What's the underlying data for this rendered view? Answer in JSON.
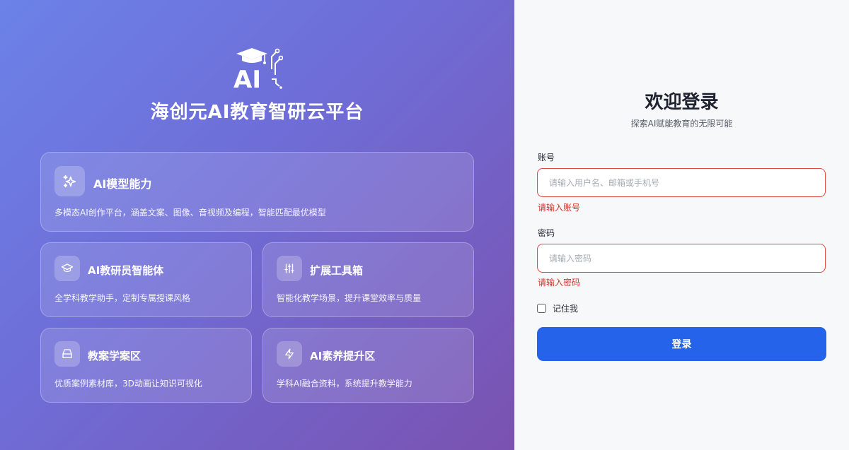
{
  "brand": {
    "logo_text": "AI",
    "title": "海创元AI教育智研云平台"
  },
  "features": [
    {
      "icon": "sparkles-icon",
      "title": "AI模型能力",
      "desc": "多模态AI创作平台，涵盖文案、图像、音视频及编程，智能匹配最优模型"
    },
    {
      "icon": "graduation-cap-icon",
      "title": "AI教研员智能体",
      "desc": "全学科教学助手，定制专属授课风格"
    },
    {
      "icon": "sliders-icon",
      "title": "扩展工具箱",
      "desc": "智能化教学场景，提升课堂效率与质量"
    },
    {
      "icon": "archive-box-icon",
      "title": "教案学案区",
      "desc": "优质案例素材库，3D动画让知识可视化"
    },
    {
      "icon": "lightning-icon",
      "title": "AI素养提升区",
      "desc": "学科AI融合资料，系统提升教学能力"
    }
  ],
  "login": {
    "heading": "欢迎登录",
    "subtitle": "探索AI赋能教育的无限可能",
    "account_label": "账号",
    "account_placeholder": "请输入用户名、邮箱或手机号",
    "account_value": "",
    "account_error": "请输入账号",
    "password_label": "密码",
    "password_placeholder": "请输入密码",
    "password_value": "",
    "password_error": "请输入密码",
    "remember_label": "记住我",
    "remember_checked": false,
    "submit_label": "登录"
  },
  "colors": {
    "primary": "#2563eb",
    "error": "#d93025",
    "gradient_start": "#6b82e8",
    "gradient_end": "#7a52b0"
  }
}
